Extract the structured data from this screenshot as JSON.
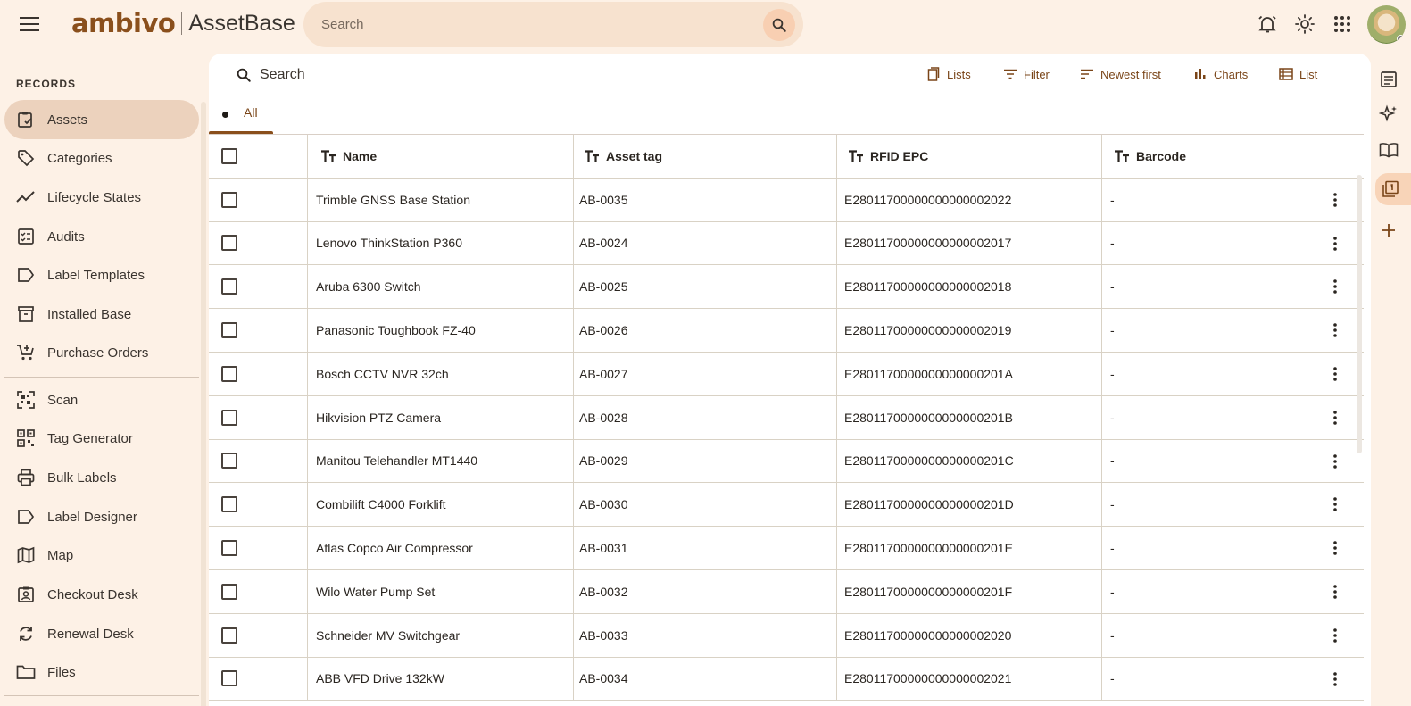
{
  "brand": {
    "logo": "ambivo",
    "app_name": "AssetBase"
  },
  "global_search": {
    "placeholder": "Search"
  },
  "sidebar": {
    "heading": "RECORDS",
    "items": [
      {
        "label": "Assets",
        "icon": "clipboard-check-icon",
        "active": true
      },
      {
        "label": "Categories",
        "icon": "tag-icon"
      },
      {
        "label": "Lifecycle States",
        "icon": "trend-line-icon"
      },
      {
        "label": "Audits",
        "icon": "checklist-icon"
      },
      {
        "label": "Label Templates",
        "icon": "label-icon"
      },
      {
        "label": "Installed Base",
        "icon": "archive-box-icon"
      },
      {
        "label": "Purchase Orders",
        "icon": "cart-add-icon"
      },
      {
        "label": "Scan",
        "icon": "qr-scan-icon"
      },
      {
        "label": "Tag Generator",
        "icon": "qr-code-icon"
      },
      {
        "label": "Bulk Labels",
        "icon": "printer-icon"
      },
      {
        "label": "Label Designer",
        "icon": "label-icon"
      },
      {
        "label": "Map",
        "icon": "map-icon"
      },
      {
        "label": "Checkout Desk",
        "icon": "badge-icon"
      },
      {
        "label": "Renewal Desk",
        "icon": "renew-icon"
      },
      {
        "label": "Files",
        "icon": "folder-icon"
      }
    ]
  },
  "panel": {
    "search_label": "Search",
    "toolbar": {
      "lists": "Lists",
      "filter": "Filter",
      "sort": "Newest first",
      "charts": "Charts",
      "view": "List"
    },
    "tab": "All"
  },
  "table": {
    "columns": [
      "Name",
      "Asset tag",
      "RFID EPC",
      "Barcode"
    ],
    "rows": [
      {
        "name": "Trimble GNSS Base Station",
        "tag": "AB-0035",
        "rfid": "E28011700000000000002022",
        "barcode": "-"
      },
      {
        "name": "Lenovo ThinkStation P360",
        "tag": "AB-0024",
        "rfid": "E28011700000000000002017",
        "barcode": "-"
      },
      {
        "name": "Aruba 6300 Switch",
        "tag": "AB-0025",
        "rfid": "E28011700000000000002018",
        "barcode": "-"
      },
      {
        "name": "Panasonic Toughbook FZ-40",
        "tag": "AB-0026",
        "rfid": "E28011700000000000002019",
        "barcode": "-"
      },
      {
        "name": "Bosch CCTV NVR 32ch",
        "tag": "AB-0027",
        "rfid": "E2801170000000000000201A",
        "barcode": "-"
      },
      {
        "name": "Hikvision PTZ Camera",
        "tag": "AB-0028",
        "rfid": "E2801170000000000000201B",
        "barcode": "-"
      },
      {
        "name": "Manitou Telehandler MT1440",
        "tag": "AB-0029",
        "rfid": "E2801170000000000000201C",
        "barcode": "-"
      },
      {
        "name": "Combilift C4000 Forklift",
        "tag": "AB-0030",
        "rfid": "E2801170000000000000201D",
        "barcode": "-"
      },
      {
        "name": "Atlas Copco Air Compressor",
        "tag": "AB-0031",
        "rfid": "E2801170000000000000201E",
        "barcode": "-"
      },
      {
        "name": "Wilo Water Pump Set",
        "tag": "AB-0032",
        "rfid": "E2801170000000000000201F",
        "barcode": "-"
      },
      {
        "name": "Schneider MV Switchgear",
        "tag": "AB-0033",
        "rfid": "E28011700000000000002020",
        "barcode": "-"
      },
      {
        "name": "ABB VFD Drive 132kW",
        "tag": "AB-0034",
        "rfid": "E28011700000000000002021",
        "barcode": "-"
      }
    ]
  },
  "colors": {
    "accent": "#8a4f1c",
    "background": "#fdf1e6",
    "active_nav": "#ecd2bd"
  }
}
